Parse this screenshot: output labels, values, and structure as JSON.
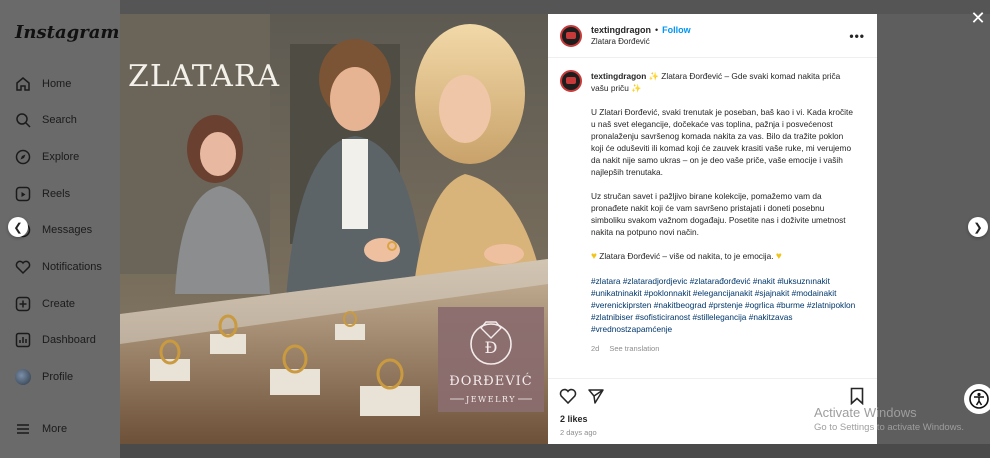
{
  "sidebar": {
    "logo": "Instagram",
    "items": [
      {
        "label": "Home",
        "icon": "home-icon"
      },
      {
        "label": "Search",
        "icon": "search-icon"
      },
      {
        "label": "Explore",
        "icon": "explore-icon"
      },
      {
        "label": "Reels",
        "icon": "reels-icon"
      },
      {
        "label": "Messages",
        "icon": "messages-icon"
      },
      {
        "label": "Notifications",
        "icon": "heart-icon"
      },
      {
        "label": "Create",
        "icon": "plus-icon"
      },
      {
        "label": "Dashboard",
        "icon": "dashboard-icon"
      },
      {
        "label": "Profile",
        "icon": "avatar"
      },
      {
        "label": "More",
        "icon": "menu-icon"
      }
    ]
  },
  "post": {
    "image": {
      "store_sign": "ZLATARA",
      "logo_name": "ĐORĐEVIĆ",
      "logo_sub": "JEWELRY"
    },
    "header": {
      "username": "textingdragon",
      "separator": "•",
      "follow": "Follow",
      "location": "Zlatara Đorđević"
    },
    "caption": {
      "username": "textingdragon",
      "title": "Zlatara Đorđević – Gde svaki komad nakita priča vašu priču",
      "p1": "U Zlatari Đorđević, svaki trenutak je poseban, baš kao i vi. Kada kročite u naš svet elegancije, dočekaće vas toplina, pažnja i posvećenost pronalaženju savršenog komada nakita za vas. Bilo da tražite poklon koji će oduševiti ili komad koji će zauvek krasiti vaše ruke, mi verujemo da nakit nije samo ukras – on je deo vaše priče, vaše emocije i vaših najlepših trenutaka.",
      "p2": "Uz stručan savet i pažljivo birane kolekcije, pomažemo vam da pronađete nakit koji će vam savršeno pristajati i doneti posebnu simboliku svakom važnom događaju. Posetite nas i doživite umetnost nakita na potpuno novi način.",
      "p3": "Zlatara Đorđević – više od nakita, to je emocija.",
      "hashtags": "#zlatara #zlataradjordjevic #zlatarađorđević #nakit #luksuznınakit #unikatninakit #poklonnakit #elegancijanakit #sjajnakit #modainakit #verenickiprsten #nakitbeograd #prstenje #ogrlica #burme #zlatnipoklon #zlatnibiser #sofisticiranost #stillelegancija #nakitzavas #vrednostzapamćenje",
      "age": "2d",
      "see_translation": "See translation"
    },
    "likes": "2 likes",
    "posted_ago": "2 days ago"
  },
  "windows": {
    "line1": "Activate Windows",
    "line2": "Go to Settings to activate Windows."
  },
  "colors": {
    "follow": "#0095f6",
    "hashtag": "#00376b",
    "overlay": "#6b6b6b"
  }
}
